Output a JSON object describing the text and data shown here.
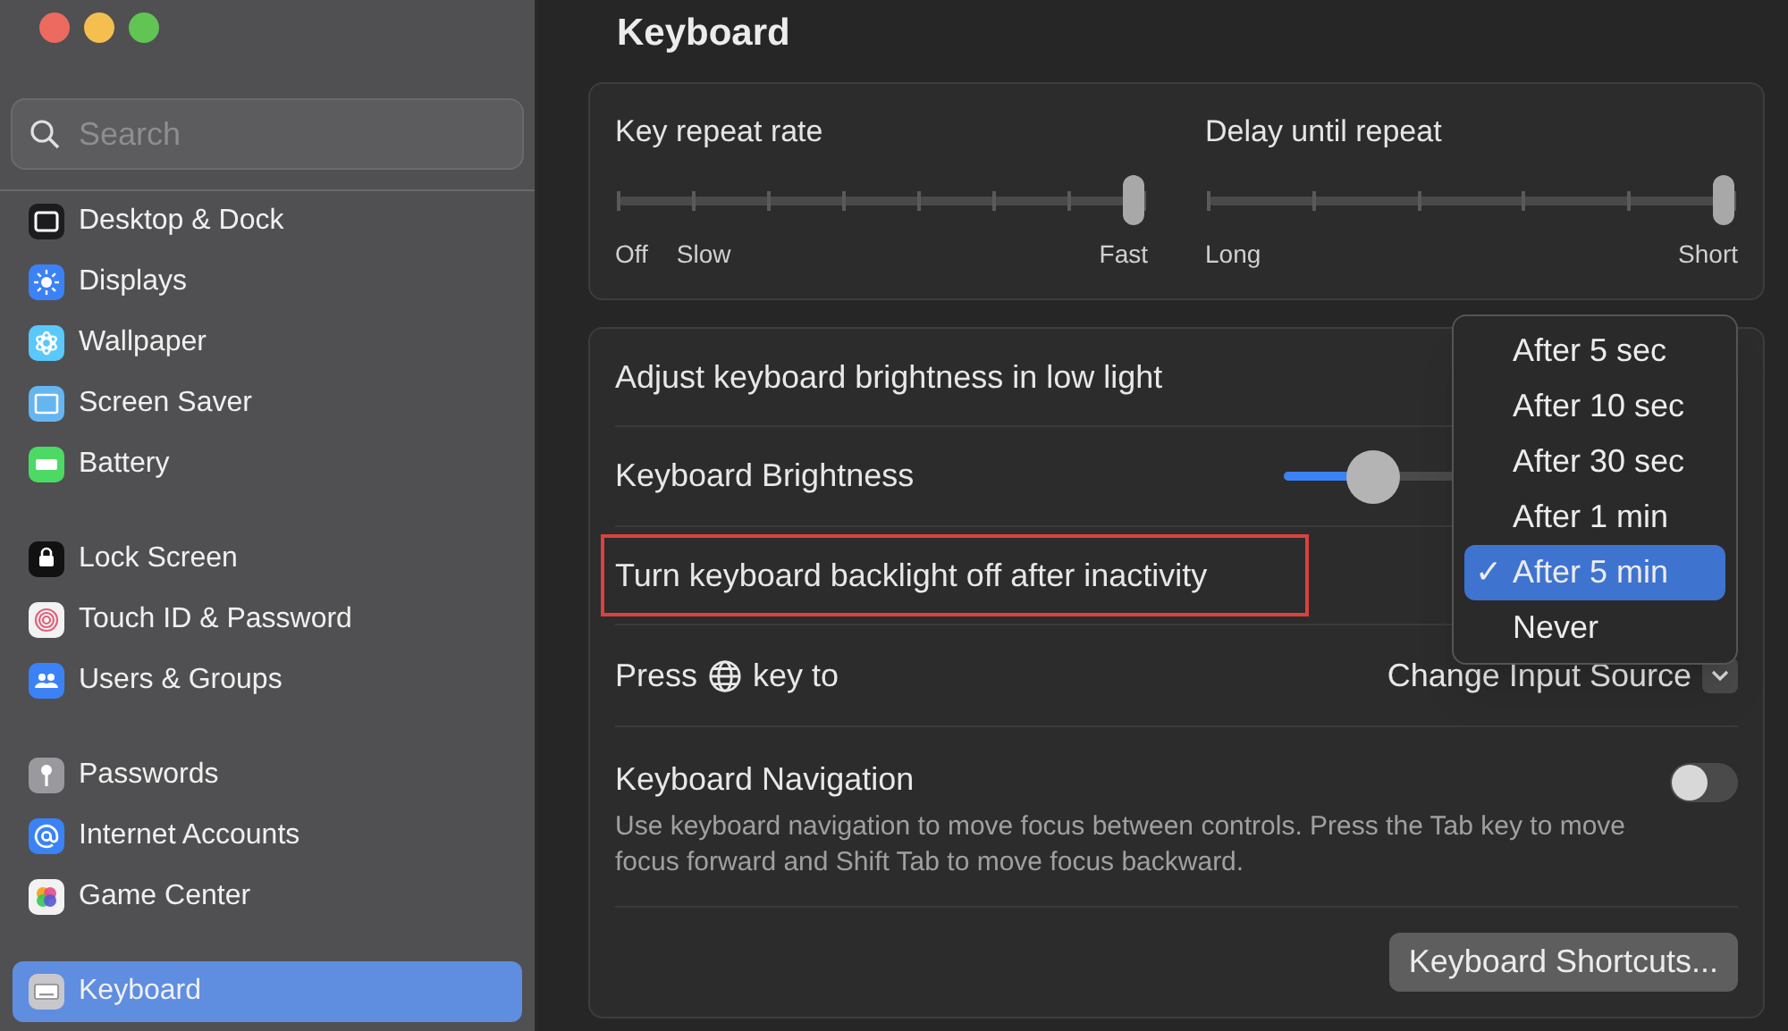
{
  "window": {
    "title": "Keyboard"
  },
  "sidebar": {
    "search": {
      "placeholder": "Search"
    },
    "groups": [
      {
        "items": [
          {
            "label": "Desktop & Dock",
            "selected": false
          },
          {
            "label": "Displays",
            "selected": false
          },
          {
            "label": "Wallpaper",
            "selected": false
          },
          {
            "label": "Screen Saver",
            "selected": false
          },
          {
            "label": "Battery",
            "selected": false
          }
        ]
      },
      {
        "items": [
          {
            "label": "Lock Screen",
            "selected": false
          },
          {
            "label": "Touch ID & Password",
            "selected": false
          },
          {
            "label": "Users & Groups",
            "selected": false
          }
        ]
      },
      {
        "items": [
          {
            "label": "Passwords",
            "selected": false
          },
          {
            "label": "Internet Accounts",
            "selected": false
          },
          {
            "label": "Game Center",
            "selected": false
          }
        ]
      },
      {
        "items": [
          {
            "label": "Keyboard",
            "selected": true
          }
        ]
      }
    ]
  },
  "repeat_sliders": [
    {
      "label": "Key repeat rate",
      "level": 1,
      "scale": [
        "Off",
        "Slow",
        "Fast"
      ]
    },
    {
      "label": "Delay until repeat",
      "level": 1,
      "scale": [
        "Long",
        "Short"
      ]
    }
  ],
  "settings": [
    {
      "kind": "plain",
      "label": "Adjust keyboard brightness in low light"
    },
    {
      "kind": "slider",
      "label": "Keyboard Brightness",
      "level": 0.2
    },
    {
      "kind": "plain",
      "label": "Turn keyboard backlight off after inactivity",
      "highlighted": true
    },
    {
      "kind": "globe",
      "label": "Press",
      "label_after": "key to",
      "value": "Change Input Source"
    },
    {
      "kind": "toggle",
      "label": "Keyboard Navigation",
      "description": "Use keyboard navigation to move focus between controls. Press the Tab key to move focus forward and Shift Tab to move focus backward.",
      "on": false
    }
  ],
  "shortcuts_button": "Keyboard Shortcuts...",
  "popup_menu": [
    {
      "label": "After 5 sec",
      "selected": false
    },
    {
      "label": "After 10 sec",
      "selected": false
    },
    {
      "label": "After 30 sec",
      "selected": false
    },
    {
      "label": "After 1 min",
      "selected": false
    },
    {
      "label": "After 5 min",
      "selected": true
    },
    {
      "label": "Never",
      "selected": false
    }
  ],
  "popup_check": "✓"
}
